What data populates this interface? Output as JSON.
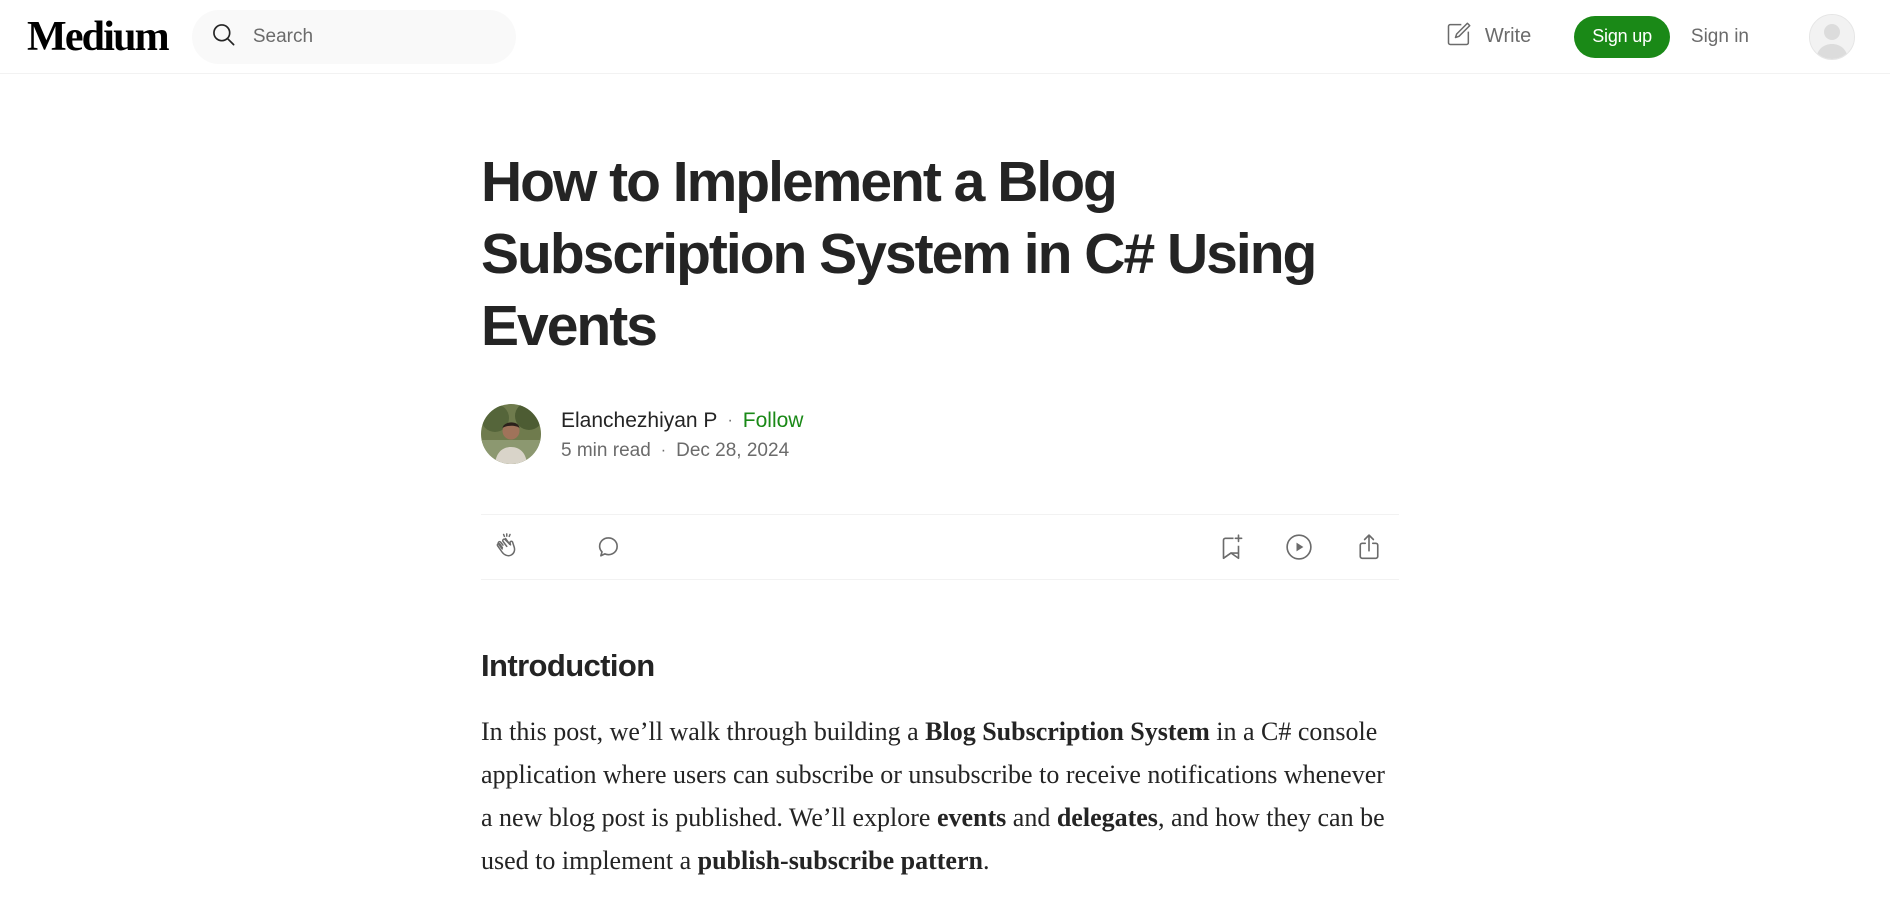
{
  "header": {
    "logo": "Medium",
    "search_placeholder": "Search",
    "write_label": "Write",
    "signup_label": "Sign up",
    "signin_label": "Sign in"
  },
  "article": {
    "title": "How to Implement a Blog Subscription System in C# Using Events",
    "author": "Elanchezhiyan P",
    "follow_label": "Follow",
    "read_time": "5 min read",
    "date": "Dec 28, 2024",
    "section_heading": "Introduction",
    "intro": {
      "p1": "In this post, we’ll walk through building a ",
      "b1": "Blog Subscription System",
      "p2": " in a C# console application where users can subscribe or unsubscribe to receive notifications whenever a new blog post is published. We’ll explore ",
      "b2": "events",
      "p3": " and ",
      "b3": "delegates",
      "p4": ", and how they can be used to implement a ",
      "b4": "publish-subscribe pattern",
      "p5": "."
    }
  },
  "icons": {
    "search": "search-icon",
    "write": "write-icon",
    "avatar": "user-avatar-icon",
    "clap": "clap-icon",
    "comment": "comment-icon",
    "bookmark": "bookmark-add-icon",
    "listen": "play-icon",
    "share": "share-icon"
  },
  "colors": {
    "accent": "#1a8917",
    "text": "#242424",
    "muted": "#6b6b6b"
  }
}
